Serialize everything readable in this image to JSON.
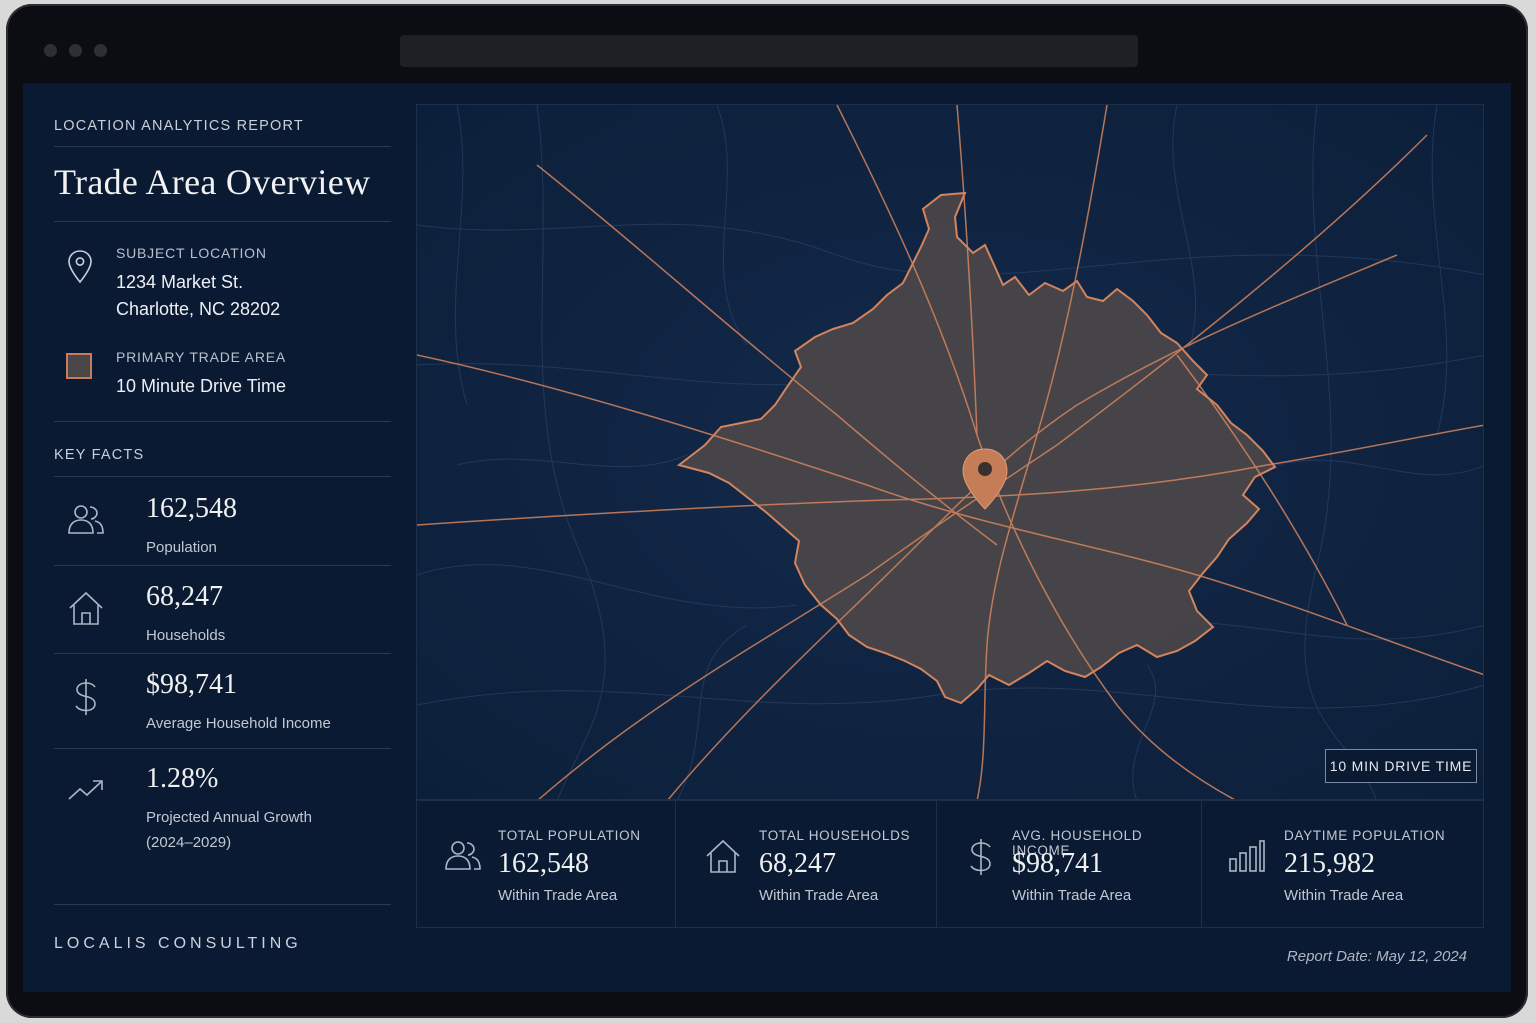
{
  "sidebar": {
    "eyebrow": "LOCATION ANALYTICS REPORT",
    "title": "Trade Area Overview",
    "subject_location": {
      "label": "SUBJECT LOCATION",
      "line1": "1234 Market St.",
      "line2": "Charlotte, NC 28202",
      "icon": "map-pin-icon"
    },
    "primary_trade_area": {
      "label": "PRIMARY TRADE AREA",
      "value": "10 Minute Drive Time",
      "swatch_fill": "#4a4548",
      "swatch_border": "#c77b57"
    },
    "key_facts_label": "KEY FACTS",
    "key_facts": [
      {
        "value": "162,548",
        "label": "Population",
        "icon": "people-icon"
      },
      {
        "value": "68,247",
        "label": "Households",
        "icon": "house-icon"
      },
      {
        "value": "$98,741",
        "label": "Average Household Income",
        "icon": "dollar-icon"
      },
      {
        "value": "1.28%",
        "label": "Projected Annual Growth",
        "label2": "(2024–2029)",
        "icon": "trend-up-icon"
      }
    ],
    "brand": "LOCALIS CONSULTING"
  },
  "map": {
    "badge": "10 MIN DRIVE TIME",
    "accent": "#d4845c",
    "background": "#0e2340",
    "trade_area_fill": "#4b4649",
    "pin_icon": "map-pin-icon"
  },
  "stats": [
    {
      "label": "TOTAL POPULATION",
      "value": "162,548",
      "sub": "Within Trade Area",
      "icon": "people-icon"
    },
    {
      "label": "TOTAL HOUSEHOLDS",
      "value": "68,247",
      "sub": "Within Trade Area",
      "icon": "house-icon"
    },
    {
      "label": "AVG. HOUSEHOLD INCOME",
      "value": "$98,741",
      "sub": "Within Trade Area",
      "icon": "dollar-icon"
    },
    {
      "label": "DAYTIME POPULATION",
      "value": "215,982",
      "sub": "Within Trade Area",
      "icon": "bar-chart-icon"
    }
  ],
  "report_date": "Report Date: May 12, 2024"
}
